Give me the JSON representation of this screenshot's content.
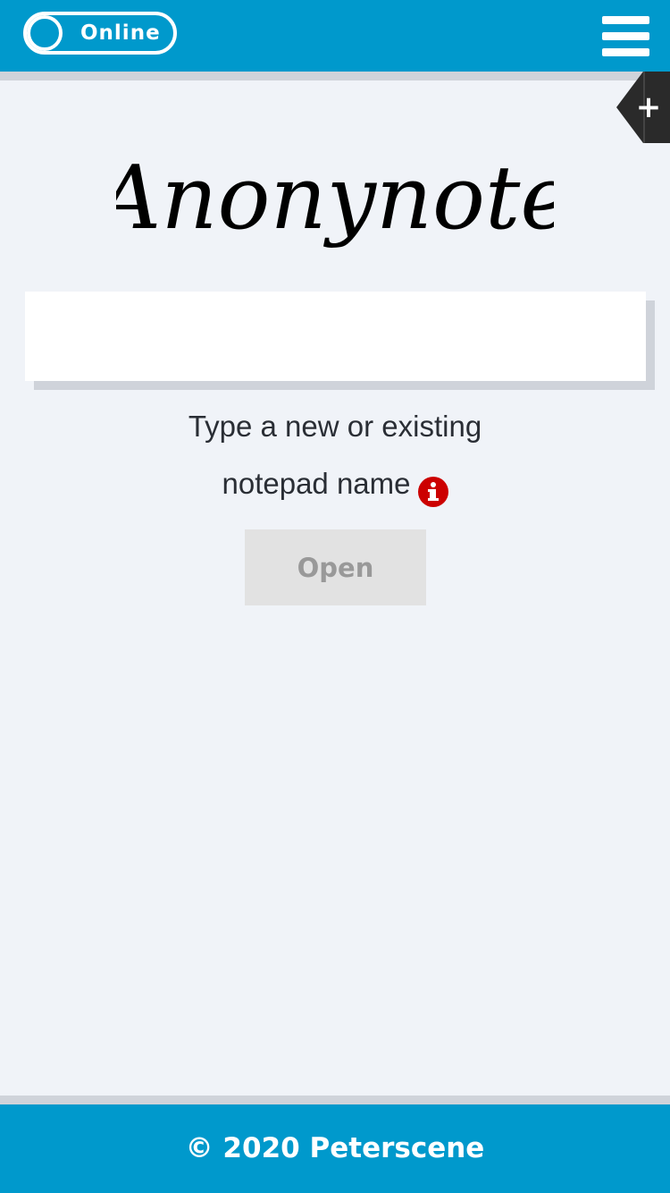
{
  "header": {
    "status_toggle_label": "Online",
    "menu_icon": "hamburger-menu-icon",
    "background_color": "#0099cc"
  },
  "side_tab": {
    "icon": "plus-icon",
    "glyph": "+"
  },
  "logo": {
    "text": "Anonynote"
  },
  "notepad_form": {
    "input_value": "",
    "hint_line1": "Type a new or existing",
    "hint_line2": "notepad name",
    "info_icon": "info-icon",
    "info_icon_color": "#cc0000",
    "open_button_label": "Open"
  },
  "footer": {
    "text": "© 2020 Peterscene",
    "background_color": "#0099cc"
  }
}
